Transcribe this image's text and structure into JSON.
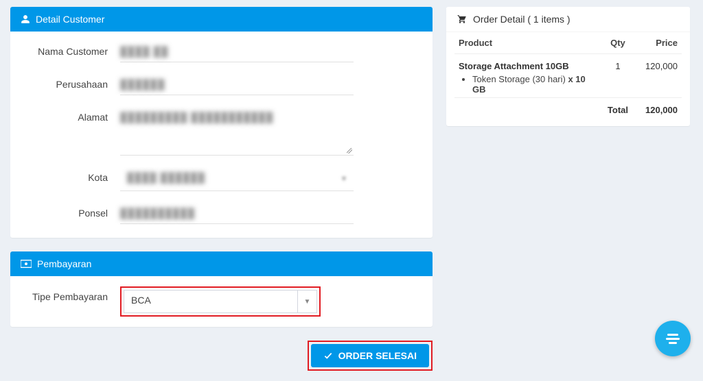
{
  "customer_panel": {
    "title": "Detail Customer",
    "fields": {
      "nama_label": "Nama Customer",
      "nama_value": "████ ██",
      "perusahaan_label": "Perusahaan",
      "perusahaan_value": "██████",
      "alamat_label": "Alamat",
      "alamat_value": "█████████ ███████████",
      "kota_label": "Kota",
      "kota_value": "████ ██████",
      "ponsel_label": "Ponsel",
      "ponsel_value": "██████████"
    }
  },
  "payment_panel": {
    "title": "Pembayaran",
    "type_label": "Tipe Pembayaran",
    "type_value": "BCA"
  },
  "order_panel": {
    "title": "Order Detail ( 1 items )",
    "headers": {
      "product": "Product",
      "qty": "Qty",
      "price": "Price"
    },
    "items": [
      {
        "name": "Storage Attachment 10GB",
        "sub_prefix": "Token Storage (30 hari) ",
        "sub_bold": "x 10 GB",
        "qty": "1",
        "price": "120,000"
      }
    ],
    "total_label": "Total",
    "total_value": "120,000"
  },
  "submit": {
    "label": "ORDER SELESAI"
  }
}
